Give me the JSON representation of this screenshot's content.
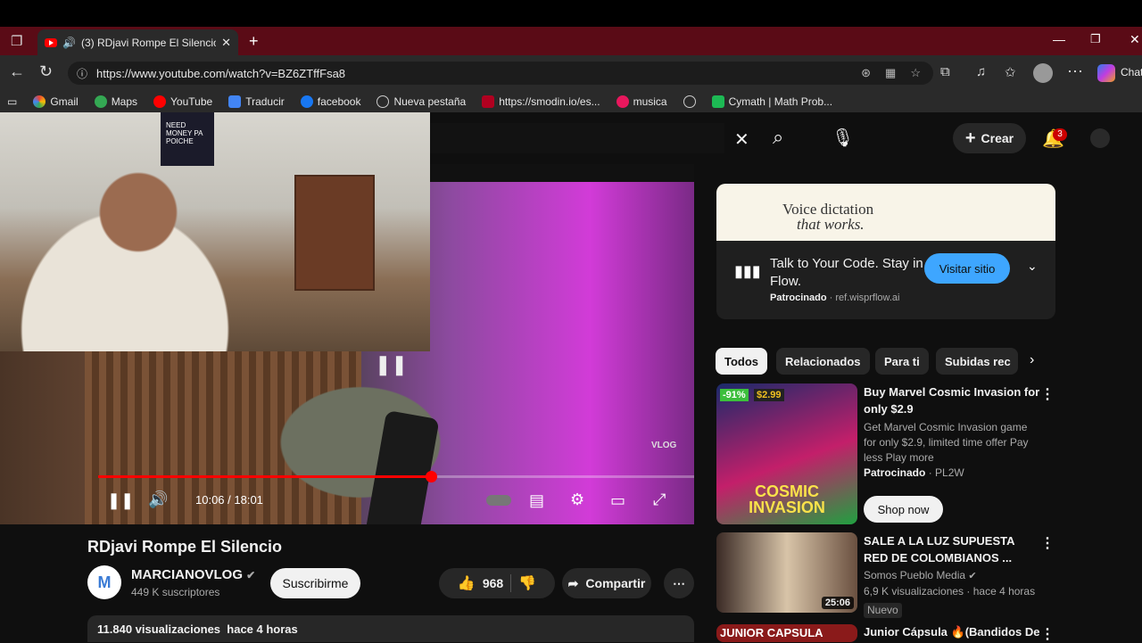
{
  "browser": {
    "tab_title": "(3) RDjavi Rompe El Silencio",
    "url": "https://www.youtube.com/watch?v=BZ6ZTffFsa8",
    "copilot_label": "Chat",
    "bookmarks": [
      "Gmail",
      "Maps",
      "YouTube",
      "Traducir",
      "facebook",
      "Nueva pestaña",
      "https://smodin.io/es...",
      "musica",
      "Cymath | Math Prob..."
    ]
  },
  "webcam": {
    "shirt_text": "NEED MONEY PA POICHE"
  },
  "header": {
    "create_label": "Crear",
    "notifications_count": "3"
  },
  "player": {
    "time": "10:06 / 18:01",
    "progress": 0.559,
    "watermark": "VLOG"
  },
  "video": {
    "title": "RDjavi Rompe El Silencio",
    "channel": "MARCIANOVLOG",
    "subscribers": "449 K suscriptores",
    "subscribe_label": "Suscribirme",
    "likes": "968",
    "share_label": "Compartir",
    "views": "11.840 visualizaciones",
    "published": "hace 4 horas"
  },
  "ad": {
    "banner_line1": "Voice dictation",
    "banner_line2": "that works.",
    "title": "Talk to Your Code. Stay in Flow.",
    "sponsored": "Patrocinado",
    "domain": "ref.wisprflow.ai",
    "cta": "Visitar sitio"
  },
  "chips": [
    "Todos",
    "Relacionados",
    "Para ti",
    "Subidas rec"
  ],
  "recommendations": [
    {
      "title": "Buy Marvel Cosmic Invasion for only $2.9",
      "description": "Get Marvel Cosmic Invasion game for only $2.9, limited time offer Pay less Play more",
      "sponsored": "Patrocinado",
      "advertiser": "PL2W",
      "cta": "Shop now",
      "discount": "-91%",
      "price": "$2.99",
      "thumb_text": "COSMIC INVASION"
    },
    {
      "title": "SALE A LA LUZ SUPUESTA RED DE COLOMBIANOS ...",
      "channel": "Somos Pueblo Media",
      "meta": "6,9 K visualizaciones · hace 4 horas",
      "badge": "Nuevo",
      "duration": "25:06"
    },
    {
      "title": "Junior Cápsula 🔥(Bandidos De",
      "thumb_text": "JUNIOR CAPSULA"
    }
  ],
  "colors": {
    "accent": "#ff0000",
    "tab_strip": "#5a0b16",
    "cta_blue": "#3ea6ff"
  }
}
